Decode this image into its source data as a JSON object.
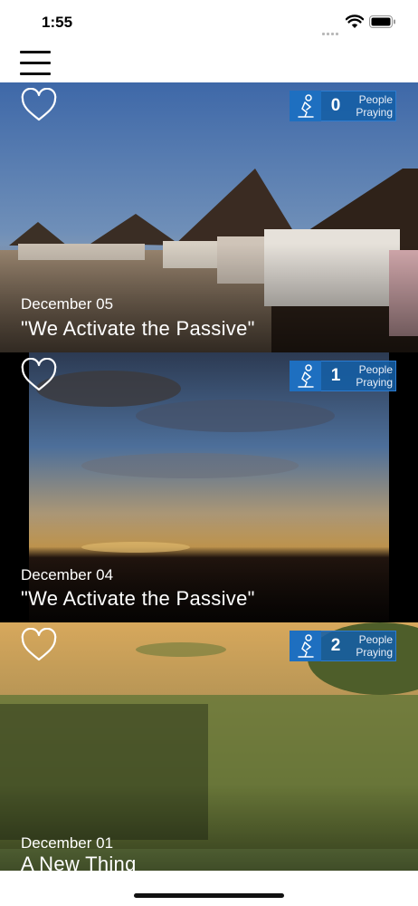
{
  "status_bar": {
    "time": "1:55",
    "icons": [
      "signal-dots-icon",
      "wifi-icon",
      "battery-icon"
    ]
  },
  "nav": {
    "menu_icon": "hamburger-menu-icon"
  },
  "colors": {
    "badge_blue": "#1e6fc0",
    "text_white": "#ffffff"
  },
  "feed": {
    "cards": [
      {
        "date": "December 05",
        "title": "\"We Activate the Passive\"",
        "count": "0",
        "label_line1": "People",
        "label_line2": "Praying"
      },
      {
        "date": "December 04",
        "title": "\"We Activate the Passive\"",
        "count": "1",
        "label_line1": "People",
        "label_line2": "Praying"
      },
      {
        "date": "December 01",
        "title": "A New Thing",
        "count": "2",
        "label_line1": "People",
        "label_line2": "Praying"
      }
    ]
  }
}
